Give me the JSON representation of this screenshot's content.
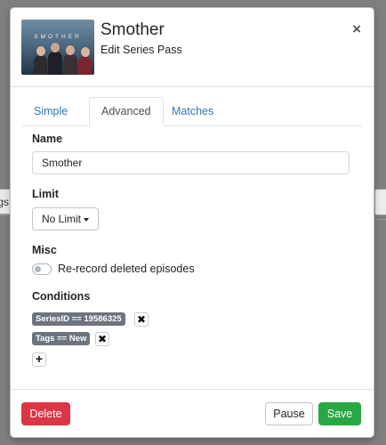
{
  "background": {
    "left_fragment": "gs"
  },
  "modal": {
    "title": "Smother",
    "subtitle": "Edit Series Pass",
    "close_glyph": "×",
    "thumbnail_text": "SMOTHER"
  },
  "tabs": [
    {
      "label": "Simple",
      "active": false
    },
    {
      "label": "Advanced",
      "active": true
    },
    {
      "label": "Matches",
      "active": false
    }
  ],
  "form": {
    "name_label": "Name",
    "name_value": "Smother",
    "limit_label": "Limit",
    "limit_value": "No Limit",
    "misc_label": "Misc",
    "rerecord_label": "Re-record deleted episodes",
    "rerecord_enabled": false,
    "conditions_label": "Conditions",
    "conditions": [
      {
        "text": "SeriesID == 19586325",
        "remove_glyph": "✖"
      },
      {
        "text": "Tags == New",
        "remove_glyph": "✖"
      }
    ],
    "add_glyph": "+"
  },
  "footer": {
    "delete_label": "Delete",
    "pause_label": "Pause",
    "save_label": "Save"
  },
  "colors": {
    "primary_link": "#2f77b8",
    "danger": "#dc3545",
    "success": "#28a745",
    "badge": "#6c757d"
  }
}
